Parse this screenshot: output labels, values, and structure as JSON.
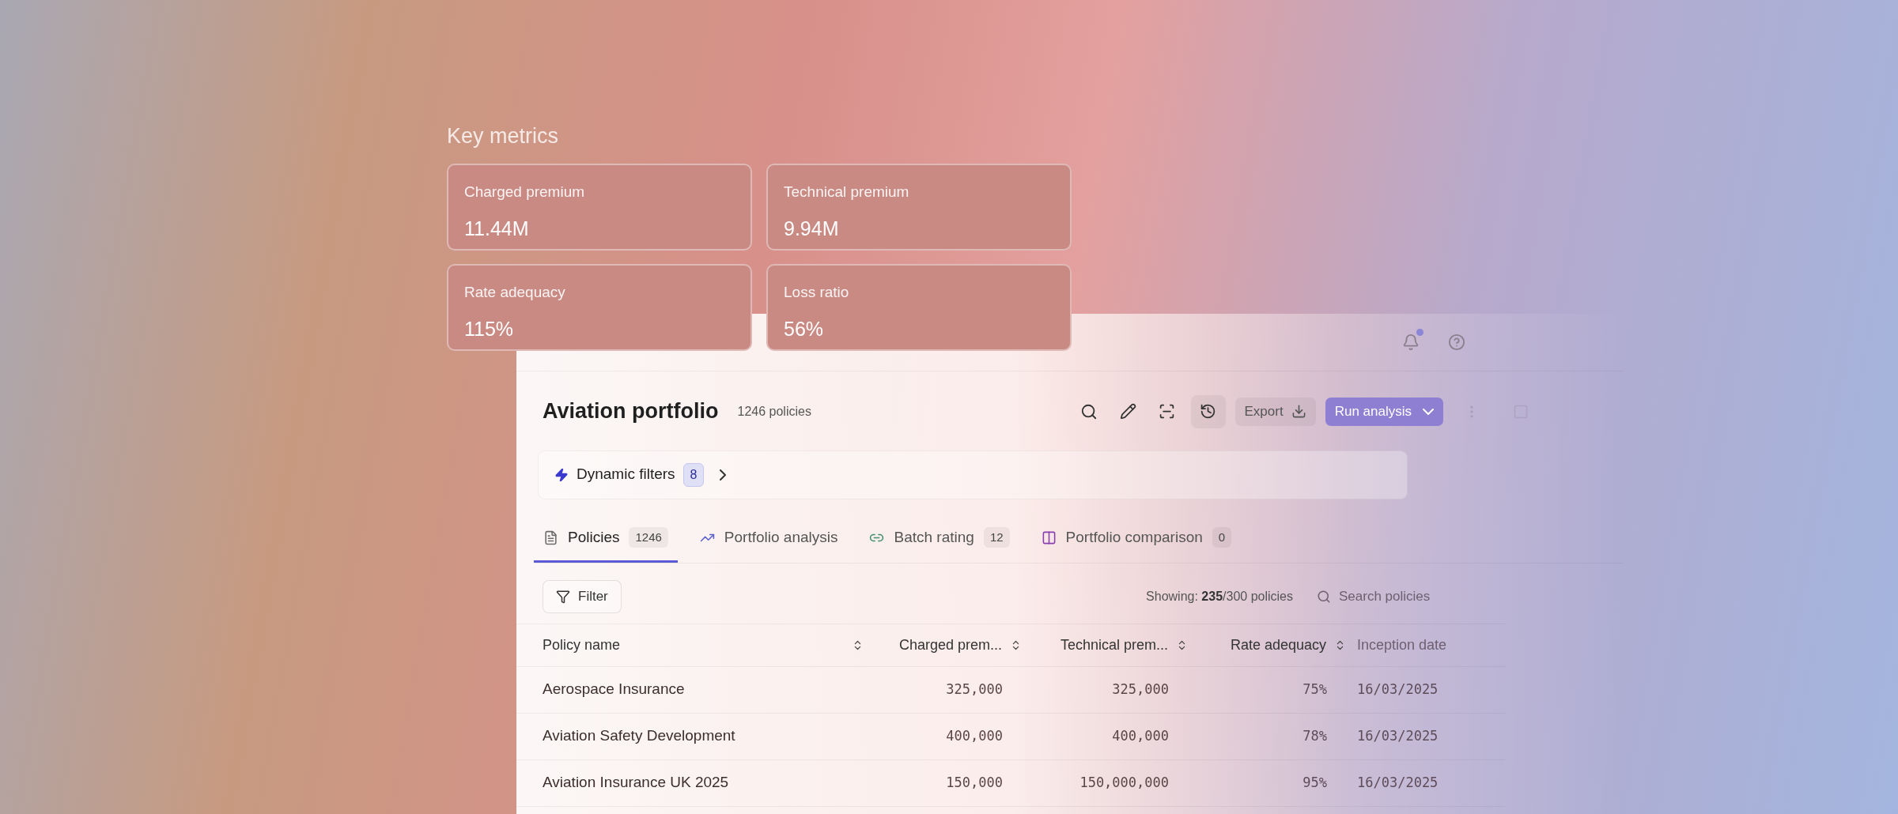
{
  "key_metrics": {
    "title": "Key metrics",
    "cards": [
      {
        "label": "Charged premium",
        "value": "11.44M"
      },
      {
        "label": "Technical premium",
        "value": "9.94M"
      },
      {
        "label": "Rate adequacy",
        "value": "115%"
      },
      {
        "label": "Loss ratio",
        "value": "56%"
      }
    ]
  },
  "top_bar": {
    "notification_unread": true
  },
  "header": {
    "title": "Aviation portfolio",
    "count": "1246 policies",
    "export": "Export",
    "run": "Run analysis"
  },
  "dynamic_filters": {
    "label": "Dynamic filters",
    "count": "8"
  },
  "tabs": [
    {
      "label": "Policies",
      "count": "1246",
      "selected": true
    },
    {
      "label": "Portfolio analysis",
      "selected": false
    },
    {
      "label": "Batch rating",
      "count": "12",
      "selected": false
    },
    {
      "label": "Portfolio comparison",
      "count": "0",
      "selected": false
    }
  ],
  "toolbar": {
    "filter": "Filter",
    "showing_label": "Showing:",
    "showing_count": "235",
    "showing_total": "/300 policies",
    "search": {
      "placeholder": "Search policies"
    }
  },
  "table": {
    "columns": [
      {
        "label": "Policy name"
      },
      {
        "label": "Charged prem..."
      },
      {
        "label": "Technical prem..."
      },
      {
        "label": "Rate adequacy"
      },
      {
        "label": "Inception date"
      }
    ],
    "rows": [
      [
        "Aerospace Insurance",
        "325,000",
        "325,000",
        "75%",
        "16/03/2025"
      ],
      [
        "Aviation Safety Development",
        "400,000",
        "400,000",
        "78%",
        "16/03/2025"
      ],
      [
        "Aviation Insurance UK 2025",
        "150,000",
        "150,000,000",
        "95%",
        "16/03/2025"
      ]
    ]
  }
}
